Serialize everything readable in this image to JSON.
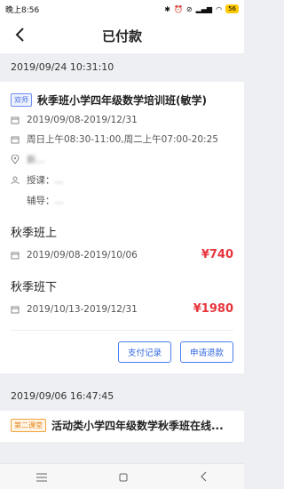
{
  "status_bar": {
    "time": "晚上8:56",
    "battery": "56"
  },
  "nav": {
    "title": "已付款"
  },
  "orders": [
    {
      "datetime": "2019/09/24 10:31:10",
      "tag": "双师",
      "title": "秋季班小学四年级数学培训班(敏学)",
      "date_range": "2019/09/08-2019/12/31",
      "schedule": "周日上午08:30-11:00,周二上午07:00-20:25",
      "location": "新...",
      "teacher_label": "授课：",
      "teacher_name": "...",
      "assistant_label": "辅导：",
      "assistant_name": "...",
      "sections": [
        {
          "name": "秋季班上",
          "date_range": "2019/09/08-2019/10/06",
          "price": "¥740"
        },
        {
          "name": "秋季班下",
          "date_range": "2019/10/13-2019/12/31",
          "price": "¥1980"
        }
      ],
      "actions": {
        "payment_records": "支付记录",
        "refund": "申请退款"
      }
    },
    {
      "datetime": "2019/09/06 16:47:45",
      "tag": "第二课堂",
      "title": "活动类小学四年级数学秋季班在线..."
    }
  ],
  "colors": {
    "accent": "#2f66e0",
    "price": "#e8343c",
    "background": "#eeeff3"
  }
}
